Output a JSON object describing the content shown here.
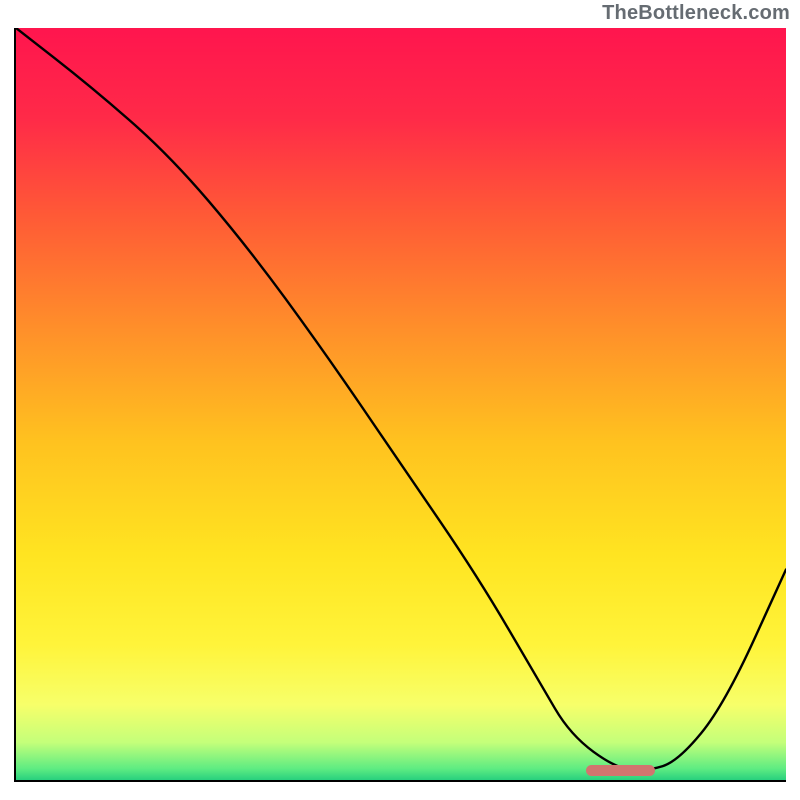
{
  "attribution": "TheBottleneck.com",
  "colors": {
    "gradient_stops": [
      {
        "pos": 0.0,
        "color": "#ff154e"
      },
      {
        "pos": 0.12,
        "color": "#ff2a48"
      },
      {
        "pos": 0.25,
        "color": "#ff5a36"
      },
      {
        "pos": 0.4,
        "color": "#ff8f2a"
      },
      {
        "pos": 0.55,
        "color": "#ffc21f"
      },
      {
        "pos": 0.7,
        "color": "#ffe421"
      },
      {
        "pos": 0.82,
        "color": "#fff43a"
      },
      {
        "pos": 0.9,
        "color": "#f7ff6a"
      },
      {
        "pos": 0.95,
        "color": "#c4ff7a"
      },
      {
        "pos": 0.985,
        "color": "#5eec82"
      },
      {
        "pos": 1.0,
        "color": "#28d07e"
      }
    ],
    "curve": "#000000",
    "marker": "#d1756f",
    "axes": "#000000"
  },
  "chart_data": {
    "type": "line",
    "title": "",
    "xlabel": "",
    "ylabel": "",
    "xlim": [
      0,
      100
    ],
    "ylim": [
      0,
      100
    ],
    "x": [
      0,
      10,
      20,
      30,
      40,
      50,
      60,
      68,
      72,
      78,
      82,
      86,
      92,
      100
    ],
    "values": [
      100,
      92,
      83,
      71,
      57,
      42,
      27,
      13,
      6,
      1.5,
      1.2,
      2.5,
      10,
      28
    ],
    "marker": {
      "x_start": 74,
      "x_end": 83,
      "y": 1.3
    },
    "legend": [],
    "grid": false
  }
}
